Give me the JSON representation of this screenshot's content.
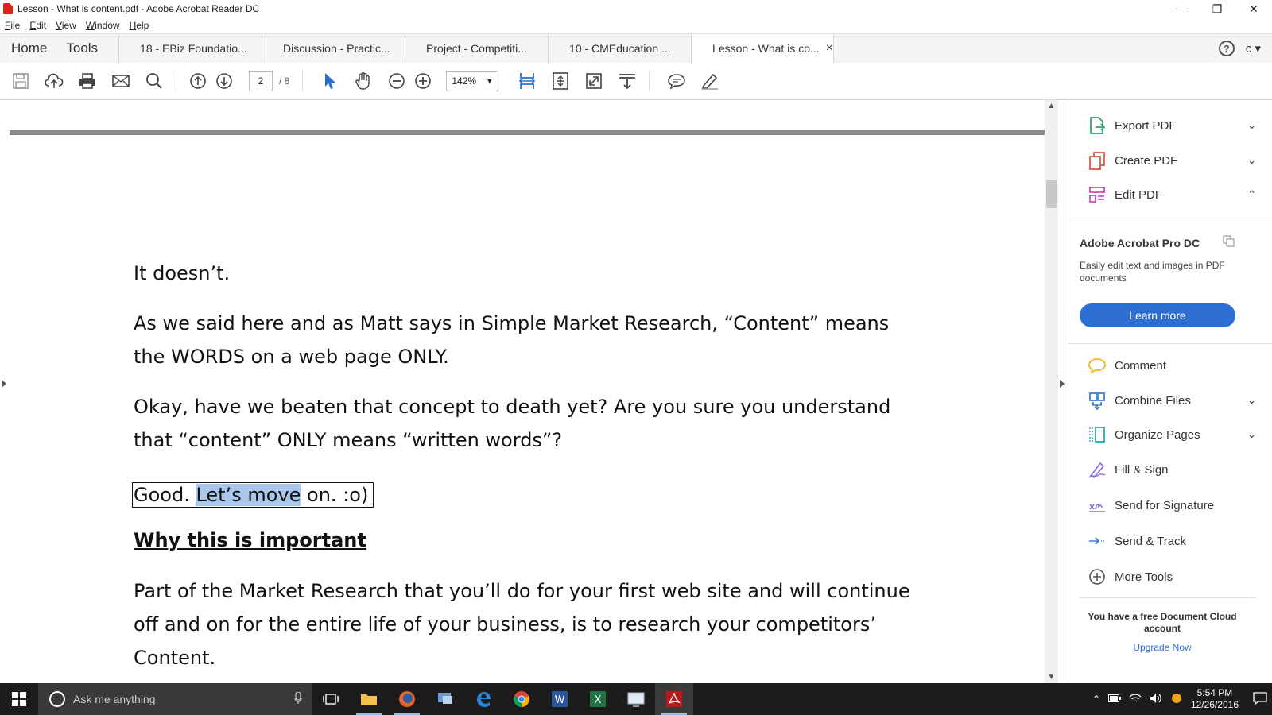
{
  "window": {
    "title": "Lesson - What is content.pdf - Adobe Acrobat Reader DC",
    "minimize": "—",
    "restore": "❐",
    "close": "✕"
  },
  "menu": [
    "File",
    "Edit",
    "View",
    "Window",
    "Help"
  ],
  "tabs": {
    "home": "Home",
    "tools": "Tools",
    "documents": [
      "18 - EBiz Foundatio...",
      "Discussion - Practic...",
      "Project - Competiti...",
      "10 -  CMEducation ...",
      "Lesson - What is co..."
    ],
    "close_glyph": "×",
    "user_initial": "c"
  },
  "toolbar": {
    "current_page": "2",
    "total_pages": "/ 8",
    "zoom": "142%"
  },
  "document": {
    "paragraph1": "It doesn’t.",
    "paragraph2_line1": "As we said here and as Matt says in Simple Market Research, “Content” means",
    "paragraph2_line2": "the WORDS on a web page ONLY.",
    "paragraph3_line1": "Okay, have we beaten that concept to death yet? Are you sure you understand",
    "paragraph3_line2": "that “content” ONLY means “written words”?",
    "boxed_pre": "Good. ",
    "boxed_highlight": "Let’s move",
    "boxed_post": " on. :o)",
    "heading": "Why this is important",
    "paragraph4_line1": "Part of the Market Research that you’ll do for your first web site and will continue",
    "paragraph4_line2": "off and on for the entire life of your business, is to research your competitors’",
    "paragraph4_line3": "Content."
  },
  "right_panel": {
    "export_pdf": "Export PDF",
    "create_pdf": "Create PDF",
    "edit_pdf": "Edit PDF",
    "promo_title": "Adobe Acrobat Pro DC",
    "promo_text": "Easily edit text and images in PDF documents",
    "learn_more": "Learn more",
    "comment": "Comment",
    "combine_files": "Combine Files",
    "organize_pages": "Organize Pages",
    "fill_sign": "Fill & Sign",
    "send_for_signature": "Send for Signature",
    "send_track": "Send & Track",
    "more_tools": "More Tools",
    "cloud_text": "You have a free Document Cloud account",
    "upgrade": "Upgrade Now"
  },
  "taskbar": {
    "search_placeholder": "Ask me anything",
    "time": "5:54 PM",
    "date": "12/26/2016"
  },
  "colors": {
    "accent_blue": "#2d6ed3",
    "selection_highlight": "#a9c8ec",
    "acrobat_red": "#d7261b"
  }
}
